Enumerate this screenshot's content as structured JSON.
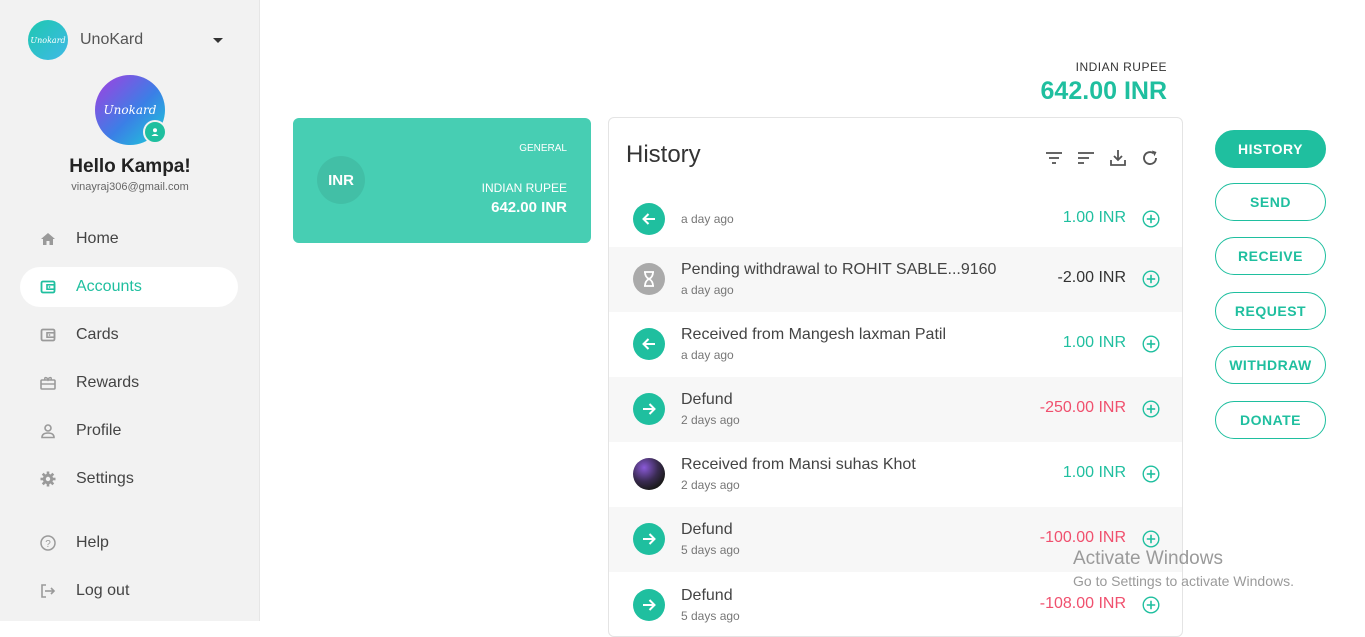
{
  "brand": {
    "logo_text": "Unokard",
    "name": "UnoKard"
  },
  "profile": {
    "avatar_text": "Unokard",
    "greeting": "Hello Kampa!",
    "email": "vinayraj306@gmail.com"
  },
  "nav": [
    {
      "label": "Home",
      "icon": "home-icon"
    },
    {
      "label": "Accounts",
      "icon": "wallet-icon"
    },
    {
      "label": "Cards",
      "icon": "card-icon"
    },
    {
      "label": "Rewards",
      "icon": "gift-icon"
    },
    {
      "label": "Profile",
      "icon": "person-icon"
    },
    {
      "label": "Settings",
      "icon": "gear-icon"
    },
    {
      "label": "Help",
      "icon": "help-icon"
    },
    {
      "label": "Log out",
      "icon": "logout-icon"
    }
  ],
  "balance": {
    "currency": "INDIAN RUPEE",
    "amount": "642.00 INR"
  },
  "card": {
    "badge": "INR",
    "type": "GENERAL",
    "currency": "INDIAN RUPEE",
    "amount": "642.00 INR"
  },
  "history": {
    "title": "History",
    "rows": [
      {
        "title": "",
        "time": "a day ago",
        "amount": "1.00 INR",
        "kind": "in"
      },
      {
        "title": "Pending withdrawal to ROHIT SABLE...9160",
        "time": "a day ago",
        "amount": "-2.00 INR",
        "kind": "pending"
      },
      {
        "title": "Received from Mangesh laxman Patil",
        "time": "a day ago",
        "amount": "1.00 INR",
        "kind": "in"
      },
      {
        "title": "Defund",
        "time": "2 days ago",
        "amount": "-250.00 INR",
        "kind": "out"
      },
      {
        "title": "Received from Mansi suhas Khot",
        "time": "2 days ago",
        "amount": "1.00 INR",
        "kind": "photo"
      },
      {
        "title": "Defund",
        "time": "5 days ago",
        "amount": "-100.00 INR",
        "kind": "out"
      },
      {
        "title": "Defund",
        "time": "5 days ago",
        "amount": "-108.00 INR",
        "kind": "out"
      }
    ]
  },
  "actions": [
    "HISTORY",
    "SEND",
    "RECEIVE",
    "REQUEST",
    "WITHDRAW",
    "DONATE"
  ],
  "watermark": {
    "title": "Activate Windows",
    "subtitle": "Go to Settings to activate Windows."
  },
  "colors": {
    "accent": "#1fbf9f",
    "negative": "#f0506e",
    "sidebar": "#f2f2f2"
  }
}
